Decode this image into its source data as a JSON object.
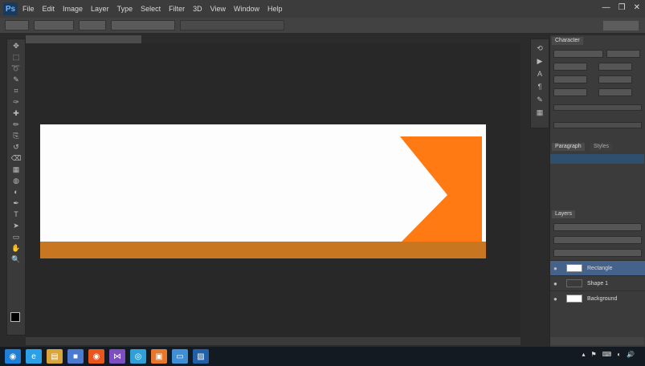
{
  "app": {
    "logo": "Ps"
  },
  "menu": [
    "File",
    "Edit",
    "Image",
    "Layer",
    "Type",
    "Select",
    "Filter",
    "3D",
    "View",
    "Window",
    "Help"
  ],
  "window_controls": [
    "—",
    "❐",
    "✕"
  ],
  "options_bar": {
    "fields": [
      "",
      "",
      "",
      "",
      ""
    ],
    "workspace": ""
  },
  "document": {
    "tab_title": "",
    "status": ""
  },
  "canvas": {
    "colors": {
      "background": "#fdfdfd",
      "bottom_band": "#c8761f",
      "arrow_block": "#ff7a12"
    }
  },
  "tools": [
    "move-icon",
    "marquee-icon",
    "lasso-icon",
    "quick-select-icon",
    "crop-icon",
    "eyedropper-icon",
    "heal-icon",
    "brush-icon",
    "stamp-icon",
    "history-brush-icon",
    "eraser-icon",
    "gradient-icon",
    "blur-icon",
    "dodge-icon",
    "pen-icon",
    "type-icon",
    "path-select-icon",
    "shape-icon",
    "hand-icon",
    "zoom-icon"
  ],
  "tool_glyphs": [
    "✥",
    "⬚",
    "➰",
    "✎",
    "⌗",
    "✑",
    "✚",
    "✏",
    "⎘",
    "↺",
    "⌫",
    "▦",
    "◍",
    "◐",
    "✒",
    "T",
    "➤",
    "▭",
    "✋",
    "🔍"
  ],
  "panels": {
    "top_tab": "Character",
    "mid_tabs": [
      "Paragraph",
      "Styles"
    ],
    "layers_tab": "Layers",
    "layers": [
      {
        "name": "Rectangle",
        "visible": true
      },
      {
        "name": "Shape 1",
        "visible": true
      },
      {
        "name": "Background",
        "visible": true
      }
    ]
  },
  "taskbar": {
    "apps": [
      {
        "name": "start-button",
        "glyph": "◉",
        "color": "#1f7fd6"
      },
      {
        "name": "ie-icon",
        "glyph": "e",
        "color": "#2aa0e8"
      },
      {
        "name": "explorer-icon",
        "glyph": "▤",
        "color": "#d9a43a"
      },
      {
        "name": "media-icon",
        "glyph": "■",
        "color": "#4a7bd1"
      },
      {
        "name": "firefox-icon",
        "glyph": "◉",
        "color": "#e8561c"
      },
      {
        "name": "vs-icon",
        "glyph": "⋈",
        "color": "#7c4ec2"
      },
      {
        "name": "chrome-icon",
        "glyph": "◎",
        "color": "#2f9fd8"
      },
      {
        "name": "office-icon",
        "glyph": "▣",
        "color": "#e8772c"
      },
      {
        "name": "photos-icon",
        "glyph": "▭",
        "color": "#3f8fd8"
      },
      {
        "name": "photoshop-icon",
        "glyph": "▨",
        "color": "#2160a8"
      }
    ],
    "tray": [
      "▴",
      "⚑",
      "⌨",
      "◐",
      "🔊"
    ],
    "clock": [
      "",
      ""
    ]
  }
}
